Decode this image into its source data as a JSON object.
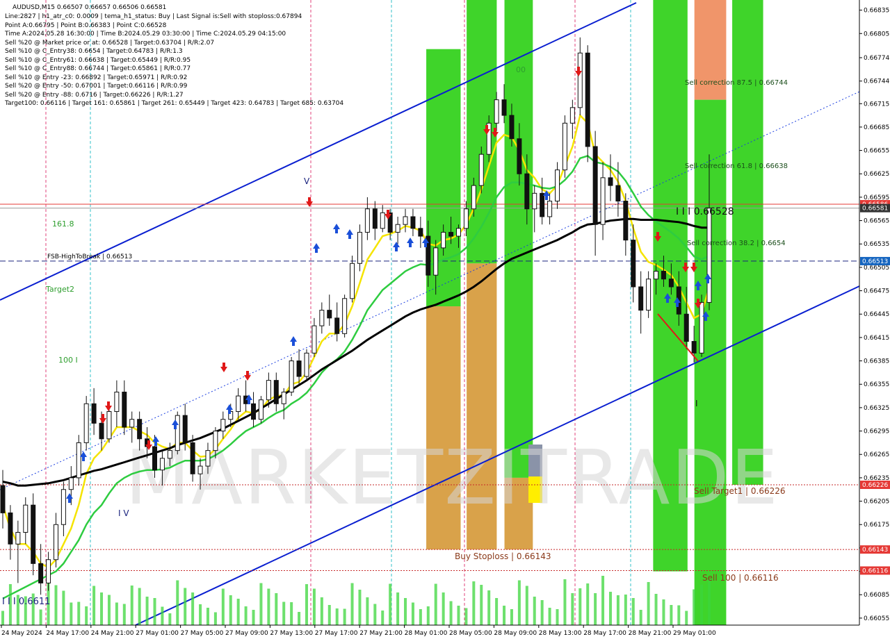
{
  "header": {
    "symbol": "AUDUSD,M15  0.66507 0.66657 0.66506 0.66581",
    "info_lines": [
      "Line:2827  |  h1_atr_c0: 0.0009  |  tema_h1_status: Buy  |  Last Signal is:Sell with stoploss:0.67894",
      "Point A:0.66795  |  Point B:0.66383  |  Point C:0.66528",
      "Time A:2024.05.28 16:30:00  |  Time B:2024.05.29 03:30:00  |  Time C:2024.05.29 04:15:00",
      "Sell %20 @ Market price or at: 0.66528  |  Target:0.63704  |  R/R:2.07",
      "Sell %10 @ C_Entry38: 0.6654  |  Target:0.64783  |  R/R:1.3",
      "Sell %10 @ C_Entry61: 0.66638  |  Target:0.65449  |  R/R:0.95",
      "Sell %10 @ C_Entry88: 0.66744  |  Target:0.65861  |  R/R:0.77",
      "Sell %10 @ Entry -23: 0.66892  |  Target:0.65971  |  R/R:0.92",
      "Sell %20 @ Entry -50: 0.67001  |  Target:0.66116  |  R/R:0.99",
      "Sell %20 @ Entry -88: 0.6716  |  Target:0.66226  |  R/R:1.27",
      "Target100: 0.66116  |  Target 161: 0.65861  |  Target 261: 0.65449  |  Target 423: 0.64783  |  Target 685: 0.63704"
    ]
  },
  "chart_data": {
    "type": "candlestick",
    "symbol": "AUDUSD",
    "timeframe": "M15",
    "ylim": [
      0.66046,
      0.66848
    ],
    "y_ticks": [
      "0.66835",
      "0.66805",
      "0.66774",
      "0.66744",
      "0.66715",
      "0.66685",
      "0.66655",
      "0.66625",
      "0.66595",
      "0.66565",
      "0.66535",
      "0.66505",
      "0.66475",
      "0.66445",
      "0.66415",
      "0.66385",
      "0.66355",
      "0.66325",
      "0.66295",
      "0.66265",
      "0.66235",
      "0.66205",
      "0.66175",
      "0.66145",
      "0.66115",
      "0.66085",
      "0.66055"
    ],
    "x_ticks": [
      "24 May 2024",
      "24 May 17:00",
      "24 May 21:00",
      "27 May 01:00",
      "27 May 05:00",
      "27 May 09:00",
      "27 May 13:00",
      "27 May 17:00",
      "27 May 21:00",
      "28 May 01:00",
      "28 May 05:00",
      "28 May 09:00",
      "28 May 13:00",
      "28 May 17:00",
      "28 May 21:00",
      "29 May 01:00"
    ],
    "price_tags": [
      {
        "value": 0.66586,
        "text": "0.66586",
        "color": "#e53935"
      },
      {
        "value": 0.66581,
        "text": "0.66581",
        "color": "#333333"
      },
      {
        "value": 0.66513,
        "text": "0.66513",
        "color": "#1565c0"
      },
      {
        "value": 0.66226,
        "text": "0.66226",
        "color": "#e53935"
      },
      {
        "value": 0.66143,
        "text": "0.66143",
        "color": "#e53935"
      },
      {
        "value": 0.66116,
        "text": "0.66116",
        "color": "#e53935"
      }
    ],
    "levels": [
      {
        "name": "FSB-HighToBreak",
        "value": 0.66513,
        "label": "FSB-HighToBreak | 0.66513",
        "style": "dashed",
        "color": "#1a237e"
      },
      {
        "name": "Sell Target1",
        "value": 0.66226,
        "label": "Sell Target1 | 0.66226",
        "style": "dotted",
        "color": "#c62828"
      },
      {
        "name": "Buy Stoploss",
        "value": 0.66143,
        "label": "Buy Stoploss | 0.66143",
        "style": "dotted",
        "color": "#c62828"
      },
      {
        "name": "Sell 100",
        "value": 0.66116,
        "label": "Sell 100 | 0.66116",
        "style": "dotted",
        "color": "#c62828"
      }
    ],
    "corrections": [
      {
        "label": "Sell correction 87.5 | 0.66744",
        "value": 0.66744
      },
      {
        "label": "Sell correction 61.8 | 0.66638",
        "value": 0.66638
      },
      {
        "label": "Sell correction 38.2 | 0.6654",
        "value": 0.6654
      }
    ],
    "point_c_label": "I I I 0.66528",
    "left_labels": [
      "161.8",
      "Target2",
      "100  I",
      "I V",
      "V",
      "I I I 0.6611",
      "I",
      "00"
    ],
    "watermark": "MARKETZITRADE",
    "candles": [
      [
        0.66225,
        0.66245,
        0.6617,
        0.6619
      ],
      [
        0.6619,
        0.662,
        0.6613,
        0.6615
      ],
      [
        0.6615,
        0.6618,
        0.661,
        0.66165
      ],
      [
        0.66165,
        0.6621,
        0.6615,
        0.662
      ],
      [
        0.662,
        0.66215,
        0.6611,
        0.66125
      ],
      [
        0.66125,
        0.6615,
        0.66085,
        0.661
      ],
      [
        0.661,
        0.6614,
        0.6609,
        0.6613
      ],
      [
        0.6613,
        0.6619,
        0.6612,
        0.66175
      ],
      [
        0.66175,
        0.6623,
        0.6616,
        0.6622
      ],
      [
        0.6622,
        0.6625,
        0.662,
        0.66235
      ],
      [
        0.66235,
        0.6629,
        0.66225,
        0.6628
      ],
      [
        0.6628,
        0.6634,
        0.6627,
        0.6633
      ],
      [
        0.6633,
        0.6635,
        0.6629,
        0.66305
      ],
      [
        0.66305,
        0.6632,
        0.6627,
        0.66285
      ],
      [
        0.66285,
        0.6633,
        0.6628,
        0.6632
      ],
      [
        0.6632,
        0.6636,
        0.663,
        0.66345
      ],
      [
        0.66345,
        0.6636,
        0.6629,
        0.663
      ],
      [
        0.663,
        0.6632,
        0.6628,
        0.6631
      ],
      [
        0.6631,
        0.6632,
        0.6627,
        0.66285
      ],
      [
        0.66285,
        0.663,
        0.6626,
        0.66275
      ],
      [
        0.66275,
        0.6629,
        0.66235,
        0.66245
      ],
      [
        0.66245,
        0.6627,
        0.66225,
        0.6626
      ],
      [
        0.6626,
        0.6628,
        0.6625,
        0.6627
      ],
      [
        0.6627,
        0.6632,
        0.66265,
        0.66315
      ],
      [
        0.66315,
        0.6633,
        0.6627,
        0.6628
      ],
      [
        0.6628,
        0.6629,
        0.6623,
        0.6624
      ],
      [
        0.6624,
        0.6626,
        0.6622,
        0.6625
      ],
      [
        0.6625,
        0.6628,
        0.6624,
        0.6627
      ],
      [
        0.6627,
        0.663,
        0.6626,
        0.66295
      ],
      [
        0.66295,
        0.6632,
        0.66285,
        0.6631
      ],
      [
        0.6631,
        0.6633,
        0.663,
        0.6632
      ],
      [
        0.6632,
        0.6635,
        0.6631,
        0.6634
      ],
      [
        0.6634,
        0.6636,
        0.6632,
        0.6633
      ],
      [
        0.6633,
        0.66345,
        0.663,
        0.6631
      ],
      [
        0.6631,
        0.6634,
        0.66305,
        0.66335
      ],
      [
        0.66335,
        0.6637,
        0.66325,
        0.6636
      ],
      [
        0.6636,
        0.6637,
        0.6632,
        0.6633
      ],
      [
        0.6633,
        0.6635,
        0.6631,
        0.66345
      ],
      [
        0.66345,
        0.6639,
        0.6634,
        0.66385
      ],
      [
        0.66385,
        0.664,
        0.66355,
        0.66365
      ],
      [
        0.66365,
        0.664,
        0.6636,
        0.66395
      ],
      [
        0.66395,
        0.6644,
        0.6639,
        0.6643
      ],
      [
        0.6643,
        0.6646,
        0.6642,
        0.6645
      ],
      [
        0.6645,
        0.6647,
        0.6643,
        0.6644
      ],
      [
        0.6644,
        0.6646,
        0.6641,
        0.6642
      ],
      [
        0.6642,
        0.6647,
        0.66415,
        0.66465
      ],
      [
        0.66465,
        0.6652,
        0.6646,
        0.6651
      ],
      [
        0.6651,
        0.6656,
        0.665,
        0.6655
      ],
      [
        0.6655,
        0.66595,
        0.6654,
        0.6658
      ],
      [
        0.6658,
        0.6659,
        0.6654,
        0.66555
      ],
      [
        0.66555,
        0.66585,
        0.6655,
        0.66575
      ],
      [
        0.66575,
        0.6658,
        0.6654,
        0.6655
      ],
      [
        0.6655,
        0.6657,
        0.66535,
        0.6656
      ],
      [
        0.6656,
        0.6658,
        0.6655,
        0.6657
      ],
      [
        0.6657,
        0.6658,
        0.66545,
        0.66555
      ],
      [
        0.66555,
        0.6657,
        0.6653,
        0.66545
      ],
      [
        0.66545,
        0.66565,
        0.6648,
        0.66495
      ],
      [
        0.66495,
        0.6654,
        0.6647,
        0.6653
      ],
      [
        0.6653,
        0.6656,
        0.6652,
        0.6655
      ],
      [
        0.6655,
        0.6657,
        0.66535,
        0.66545
      ],
      [
        0.66545,
        0.6656,
        0.6653,
        0.66555
      ],
      [
        0.66555,
        0.6659,
        0.66545,
        0.6658
      ],
      [
        0.6658,
        0.6662,
        0.6657,
        0.6661
      ],
      [
        0.6661,
        0.6666,
        0.666,
        0.6665
      ],
      [
        0.6665,
        0.667,
        0.6664,
        0.6669
      ],
      [
        0.6669,
        0.6673,
        0.6668,
        0.6672
      ],
      [
        0.6672,
        0.6674,
        0.6669,
        0.667
      ],
      [
        0.667,
        0.66715,
        0.6666,
        0.6667
      ],
      [
        0.6667,
        0.6669,
        0.6661,
        0.66625
      ],
      [
        0.66625,
        0.6665,
        0.6656,
        0.6658
      ],
      [
        0.6658,
        0.6661,
        0.6655,
        0.666
      ],
      [
        0.666,
        0.6662,
        0.6656,
        0.6657
      ],
      [
        0.6657,
        0.666,
        0.6656,
        0.6659
      ],
      [
        0.6659,
        0.6664,
        0.6658,
        0.6663
      ],
      [
        0.6663,
        0.667,
        0.6662,
        0.6669
      ],
      [
        0.6669,
        0.6672,
        0.6667,
        0.6671
      ],
      [
        0.6671,
        0.668,
        0.667,
        0.6678
      ],
      [
        0.6678,
        0.6679,
        0.6664,
        0.6666
      ],
      [
        0.6666,
        0.6668,
        0.6652,
        0.6656
      ],
      [
        0.6656,
        0.6664,
        0.6654,
        0.6662
      ],
      [
        0.6662,
        0.6665,
        0.6659,
        0.6661
      ],
      [
        0.6661,
        0.6664,
        0.6657,
        0.6659
      ],
      [
        0.6659,
        0.666,
        0.6652,
        0.6654
      ],
      [
        0.6654,
        0.6656,
        0.6646,
        0.6648
      ],
      [
        0.6648,
        0.665,
        0.6642,
        0.6645
      ],
      [
        0.6645,
        0.665,
        0.6644,
        0.6649
      ],
      [
        0.6649,
        0.6651,
        0.6647,
        0.665
      ],
      [
        0.665,
        0.6652,
        0.6648,
        0.6649
      ],
      [
        0.6649,
        0.6651,
        0.6647,
        0.6648
      ],
      [
        0.6648,
        0.665,
        0.6643,
        0.66445
      ],
      [
        0.66445,
        0.6648,
        0.664,
        0.6641
      ],
      [
        0.6641,
        0.6643,
        0.66383,
        0.66395
      ],
      [
        0.66395,
        0.6647,
        0.6639,
        0.6646
      ],
      [
        0.6646,
        0.6665,
        0.6645,
        0.66581
      ]
    ],
    "indicators": [
      {
        "name": "EMA yellow",
        "color": "#f5e400",
        "values": [
          0.662,
          0.6617,
          0.6615,
          0.6615,
          0.6614,
          0.66125,
          0.6612,
          0.6613,
          0.6615,
          0.6617,
          0.662,
          0.6624,
          0.6626,
          0.6627,
          0.66285,
          0.663,
          0.663,
          0.663,
          0.66295,
          0.6629,
          0.6628,
          0.66275,
          0.66272,
          0.6628,
          0.6628,
          0.6627,
          0.66262,
          0.66263,
          0.66272,
          0.66285,
          0.66297,
          0.66312,
          0.6632,
          0.66318,
          0.66323,
          0.66335,
          0.6634,
          0.66341,
          0.66355,
          0.66358,
          0.6637,
          0.6639,
          0.6641,
          0.6642,
          0.6642,
          0.66432,
          0.66455,
          0.66485,
          0.66515,
          0.6653,
          0.66545,
          0.66548,
          0.66552,
          0.66558,
          0.66556,
          0.66552,
          0.66535,
          0.66533,
          0.6654,
          0.66542,
          0.66547,
          0.6656,
          0.6658,
          0.66605,
          0.66635,
          0.66665,
          0.66675,
          0.66672,
          0.66655,
          0.6663,
          0.6662,
          0.66605,
          0.666,
          0.6661,
          0.66635,
          0.6666,
          0.667,
          0.6669,
          0.6665,
          0.6664,
          0.6663,
          0.66615,
          0.6659,
          0.66555,
          0.66525,
          0.66512,
          0.66508,
          0.66502,
          0.66495,
          0.6648,
          0.6646,
          0.6644,
          0.66445,
          0.6648
        ]
      },
      {
        "name": "EMA green",
        "color": "#2ecc40",
        "values": [
          0.6608,
          0.66085,
          0.6609,
          0.66095,
          0.661,
          0.66105,
          0.6611,
          0.66115,
          0.66125,
          0.6614,
          0.66155,
          0.66175,
          0.6619,
          0.662,
          0.66215,
          0.66228,
          0.66235,
          0.6624,
          0.66243,
          0.66245,
          0.66245,
          0.66246,
          0.66248,
          0.66253,
          0.66257,
          0.66257,
          0.66257,
          0.66259,
          0.66264,
          0.6627,
          0.66278,
          0.66287,
          0.66295,
          0.663,
          0.66305,
          0.66312,
          0.66318,
          0.66322,
          0.6633,
          0.66336,
          0.66344,
          0.66356,
          0.6637,
          0.6638,
          0.66387,
          0.66397,
          0.66412,
          0.6643,
          0.6645,
          0.66463,
          0.66476,
          0.66484,
          0.66492,
          0.665,
          0.66505,
          0.66509,
          0.66508,
          0.6651,
          0.66515,
          0.66518,
          0.66522,
          0.6653,
          0.66542,
          0.66557,
          0.66575,
          0.66595,
          0.66608,
          0.66614,
          0.66614,
          0.66612,
          0.6661,
          0.66607,
          0.66606,
          0.66609,
          0.66617,
          0.66628,
          0.66645,
          0.66648,
          0.6664,
          0.66638,
          0.66634,
          0.66628,
          0.66616,
          0.666,
          0.66583,
          0.66572,
          0.66564,
          0.66557,
          0.6655,
          0.66542,
          0.66531,
          0.66519,
          0.66515,
          0.6652
        ]
      },
      {
        "name": "MA black",
        "color": "#000000",
        "values": [
          0.6623,
          0.66228,
          0.66225,
          0.66225,
          0.66226,
          0.66227,
          0.66228,
          0.6623,
          0.66232,
          0.66235,
          0.66238,
          0.66241,
          0.66244,
          0.66246,
          0.66249,
          0.66252,
          0.66255,
          0.66258,
          0.66261,
          0.66264,
          0.66267,
          0.6627,
          0.66273,
          0.66277,
          0.6628,
          0.66283,
          0.66286,
          0.6629,
          0.66294,
          0.66298,
          0.66303,
          0.66308,
          0.66313,
          0.66318,
          0.66324,
          0.6633,
          0.66336,
          0.66342,
          0.66348,
          0.66354,
          0.6636,
          0.66367,
          0.66374,
          0.6638,
          0.66386,
          0.66392,
          0.66398,
          0.66405,
          0.66412,
          0.66418,
          0.66424,
          0.6643,
          0.66436,
          0.66442,
          0.66447,
          0.66451,
          0.66454,
          0.66457,
          0.66461,
          0.66465,
          0.66469,
          0.66474,
          0.6648,
          0.66487,
          0.66495,
          0.66503,
          0.6651,
          0.66516,
          0.6652,
          0.66524,
          0.66528,
          0.66532,
          0.66536,
          0.6654,
          0.66545,
          0.6655,
          0.66556,
          0.6656,
          0.66561,
          0.66563,
          0.66565,
          0.66566,
          0.66567,
          0.66567,
          0.66566,
          0.66566,
          0.66566,
          0.66565,
          0.66564,
          0.66563,
          0.66561,
          0.66558,
          0.66556,
          0.66556
        ]
      }
    ],
    "zones": [
      {
        "x0": 0.496,
        "x1": 0.536,
        "y_top": 0.66785,
        "y_mid": 0.66455,
        "y_bottom": 0.66143,
        "top_color": "#3fd42a",
        "bottom_color": "#d9a24a"
      },
      {
        "x0": 0.543,
        "x1": 0.578,
        "y_top": 0.66848,
        "y_mid": 0.6651,
        "y_bottom": 0.66143,
        "top_color": "#3fd42a",
        "bottom_color": "#d9a24a"
      },
      {
        "x0": 0.587,
        "x1": 0.62,
        "y_top": 0.66848,
        "y_mid": 0.66235,
        "y_bottom": 0.66143,
        "top_color": "#3fd42a",
        "bottom_color": "#d9a24a"
      },
      {
        "x0": 0.76,
        "x1": 0.8,
        "y_top": 0.66848,
        "y_mid": 0.66115,
        "y_bottom": 0.66115,
        "top_color": "#3fd42a",
        "bottom_color": "#3fd42a"
      },
      {
        "x0": 0.808,
        "x1": 0.845,
        "y_top": 0.66848,
        "y_mid": 0.6672,
        "y_bottom": 0.66046,
        "top_color": "#f0956a",
        "bottom_color": "#3fd42a"
      },
      {
        "x0": 0.852,
        "x1": 0.888,
        "y_top": 0.66848,
        "y_mid": 0.66226,
        "y_bottom": 0.66226,
        "top_color": "#3fd42a",
        "bottom_color": "#3fd42a"
      }
    ]
  }
}
